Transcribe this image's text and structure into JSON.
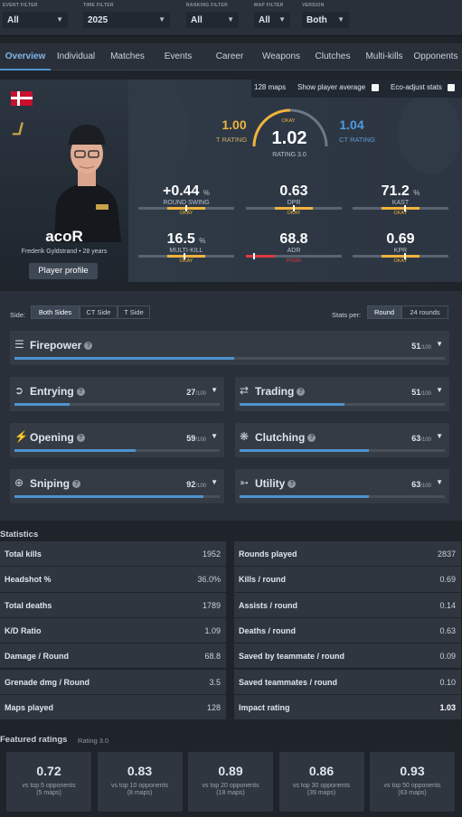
{
  "filters": [
    {
      "label": "EVENT FILTER",
      "value": "All"
    },
    {
      "label": "TIME FILTER",
      "value": "2025"
    },
    {
      "label": "RANKING FILTER",
      "value": "All"
    },
    {
      "label": "MAP FILTER",
      "value": "All"
    },
    {
      "label": "VERSION",
      "value": "Both"
    }
  ],
  "tabs": [
    "Overview",
    "Individual",
    "Matches",
    "Events",
    "Career",
    "Weapons",
    "Clutches",
    "Multi-kills",
    "Opponents"
  ],
  "hero": {
    "maps_count": "128 maps",
    "show_avg_label": "Show player average",
    "eco_label": "Eco-adjust stats",
    "nickname": "acoR",
    "realname": "Frederik Gyldstrand • 28 years",
    "profile_button": "Player profile",
    "t_rating": "1.00",
    "t_label": "T RATING",
    "ct_rating": "1.04",
    "ct_label": "CT RATING",
    "rating_quality": "OKAY",
    "rating": "1.02",
    "rating_label": "RATING 3.0",
    "accent_t": "#f0b33c",
    "accent_ct": "#4f9be0",
    "stats": [
      {
        "value": "+0.44",
        "unit": "%",
        "label": "ROUND SWING",
        "quality": "OKAY",
        "qcolor": "#f0b33c"
      },
      {
        "value": "0.63",
        "unit": "",
        "label": "DPR",
        "quality": "OKAY",
        "qcolor": "#f0b33c"
      },
      {
        "value": "71.2",
        "unit": "%",
        "label": "KAST",
        "quality": "OKAY",
        "qcolor": "#f0b33c"
      },
      {
        "value": "16.5",
        "unit": "%",
        "label": "MULTI-KILL",
        "quality": "OKAY",
        "qcolor": "#f0b33c"
      },
      {
        "value": "68.8",
        "unit": "",
        "label": "ADR",
        "quality": "POOR",
        "qcolor": "#e0393e"
      },
      {
        "value": "0.69",
        "unit": "",
        "label": "KPR",
        "quality": "OKAY",
        "qcolor": "#f0b33c"
      }
    ]
  },
  "side": {
    "label": "Side:",
    "options": [
      "Both Sides",
      "CT Side",
      "T Side"
    ],
    "stats_per_label": "Stats per:",
    "per_options": [
      "Round",
      "24 rounds"
    ]
  },
  "categories": [
    {
      "name": "Firepower",
      "score": "51",
      "max": "/100",
      "fill": 0.51,
      "icon": "crosshair-lines-icon"
    },
    {
      "name": "Entrying",
      "score": "27",
      "max": "/100",
      "fill": 0.27,
      "icon": "door-entry-icon"
    },
    {
      "name": "Trading",
      "score": "51",
      "max": "/100",
      "fill": 0.51,
      "icon": "trade-arrows-icon"
    },
    {
      "name": "Opening",
      "score": "59",
      "max": "/100",
      "fill": 0.59,
      "icon": "opening-bolt-icon"
    },
    {
      "name": "Clutching",
      "score": "63",
      "max": "/100",
      "fill": 0.63,
      "icon": "clutch-gear-icon"
    },
    {
      "name": "Sniping",
      "score": "92",
      "max": "/100",
      "fill": 0.92,
      "icon": "scope-icon"
    },
    {
      "name": "Utility",
      "score": "63",
      "max": "/100",
      "fill": 0.63,
      "icon": "grenade-icon"
    }
  ],
  "statistics": {
    "title": "Statistics",
    "left": [
      {
        "k": "Total kills",
        "v": "1952"
      },
      {
        "k": "Headshot %",
        "v": "36.0%"
      },
      {
        "k": "Total deaths",
        "v": "1789"
      },
      {
        "k": "K/D Ratio",
        "v": "1.09"
      },
      {
        "k": "Damage / Round",
        "v": "68.8"
      },
      {
        "k": "Grenade dmg / Round",
        "v": "3.5"
      },
      {
        "k": "Maps played",
        "v": "128"
      }
    ],
    "right": [
      {
        "k": "Rounds played",
        "v": "2837"
      },
      {
        "k": "Kills / round",
        "v": "0.69"
      },
      {
        "k": "Assists / round",
        "v": "0.14"
      },
      {
        "k": "Deaths / round",
        "v": "0.63"
      },
      {
        "k": "Saved by teammate / round",
        "v": "0.09"
      },
      {
        "k": "Saved teammates / round",
        "v": "0.10"
      },
      {
        "k": "Impact rating",
        "v": "1.03"
      }
    ]
  },
  "featured": {
    "title": "Featured ratings",
    "subtitle": "Rating 3.0",
    "items": [
      {
        "value": "0.72",
        "label": "vs top 5 opponents",
        "maps": "(5 maps)"
      },
      {
        "value": "0.83",
        "label": "vs top 10 opponents",
        "maps": "(8 maps)"
      },
      {
        "value": "0.89",
        "label": "vs top 20 opponents",
        "maps": "(18 maps)"
      },
      {
        "value": "0.86",
        "label": "vs top 30 opponents",
        "maps": "(39 maps)"
      },
      {
        "value": "0.93",
        "label": "vs top 50 opponents",
        "maps": "(63 maps)"
      }
    ]
  }
}
